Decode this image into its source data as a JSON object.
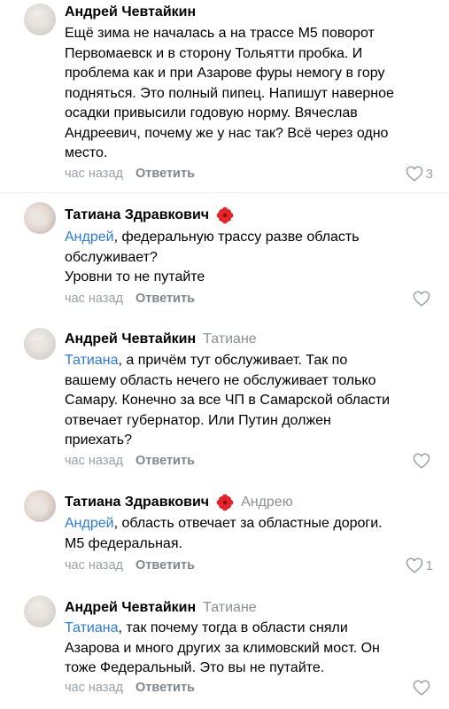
{
  "comments": [
    {
      "author": "Андрей Чевтайкин",
      "reply_to": "",
      "mention": "",
      "text_lines": [
        "Ещё зима не началась а на трассе М5 поворот",
        "Первомаевск и в сторону Тольятти пробка. И",
        "проблема как и при Азарове фуры немогу в гору",
        "подняться. Это полный пипец. Напишут наверное",
        "осадки привысили годовую норму. Вячеслав",
        "Андреевич, почему же у нас так? Всё через одно",
        "место."
      ],
      "time": "час назад",
      "reply_label": "Ответить",
      "likes": "3"
    },
    {
      "author": "Татиана Здравкович",
      "reply_to": "",
      "mention": "Андрей",
      "text_lines": [
        ", федеральную трассу разве область",
        "обслуживает?",
        "Уровни то не путайте"
      ],
      "time": "час назад",
      "reply_label": "Ответить",
      "likes": ""
    },
    {
      "author": "Андрей Чевтайкин",
      "reply_to": "Татиане",
      "mention": "Татиана",
      "text_lines": [
        ", а причём тут обслуживает. Так по",
        "вашему область нечего не обслуживает только",
        "Самару. Конечно за все ЧП в Самарской области",
        "отвечает губернатор. Или Путин должен",
        "приехать?"
      ],
      "time": "час назад",
      "reply_label": "Ответить",
      "likes": ""
    },
    {
      "author": "Татиана Здравкович",
      "reply_to": "Андрею",
      "mention": "Андрей",
      "text_lines": [
        ", область отвечает за областные дороги.",
        "М5 федеральная."
      ],
      "time": "час назад",
      "reply_label": "Ответить",
      "likes": "1"
    },
    {
      "author": "Андрей Чевтайкин",
      "reply_to": "Татиане",
      "mention": "Татиана",
      "text_lines": [
        ", так почему тогда в области сняли",
        "Азарова и много других за климовский мост. Он",
        "тоже Федеральный. Это вы не путайте."
      ],
      "time": "час назад",
      "reply_label": "Ответить",
      "likes": ""
    }
  ],
  "colors": {
    "mention": "#2d7bd6",
    "secondary_text": "#9aa0a6",
    "flower_badge": "#e0242a"
  },
  "icons": {
    "like": "heart-outline-icon",
    "badge": "red-flower-icon"
  }
}
